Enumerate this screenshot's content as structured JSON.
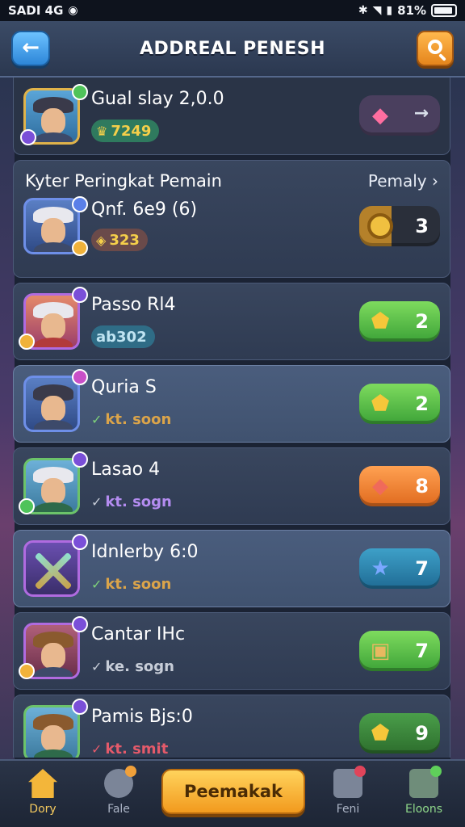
{
  "status_bar": {
    "carrier": "SADI 4G",
    "battery": "81%"
  },
  "header": {
    "title": "ADDREAL PENESH",
    "back_icon": "arrow-left-icon",
    "search_icon": "search-icon"
  },
  "top_entry": {
    "name": "Gual slay 2,0.0",
    "score": "7249",
    "chip_icon": "pink-gem-icon",
    "chip_action": "arrow-right-icon"
  },
  "section": {
    "title": "Kyter Peringkat Pemain",
    "link": "Pemaly",
    "entry": {
      "name": "Qnf. 6e9 (6)",
      "score": "323",
      "rank": "3"
    }
  },
  "players": [
    {
      "name": "Passo Rl4",
      "tag": "ab302",
      "rank": "2",
      "chip": "green",
      "gem": "gold-gem-icon"
    },
    {
      "name": "Quria S",
      "status": "kt. soon",
      "rank": "2",
      "chip": "green",
      "gem": "gold-gem-icon"
    },
    {
      "name": "Lasao 4",
      "status": "kt. sogn",
      "rank": "8",
      "chip": "orange",
      "gem": "red-gem-icon"
    },
    {
      "name": "Idnlerby 6:0",
      "status": "kt. soon",
      "rank": "7",
      "chip": "teal",
      "gem": "blue-star-icon"
    },
    {
      "name": "Cantar IHc",
      "status": "ke. sogn",
      "rank": "7",
      "chip": "green",
      "gem": "box-icon"
    },
    {
      "name": "Pamis Bjs:0",
      "status": "kt. smit",
      "rank": "9",
      "chip": "darkgreen",
      "gem": "gold-gem-icon"
    }
  ],
  "bottom_nav": {
    "home": "Dory",
    "fale": "Fale",
    "primary": "Peemakak",
    "feni": "Feni",
    "eloons": "Eloons"
  }
}
